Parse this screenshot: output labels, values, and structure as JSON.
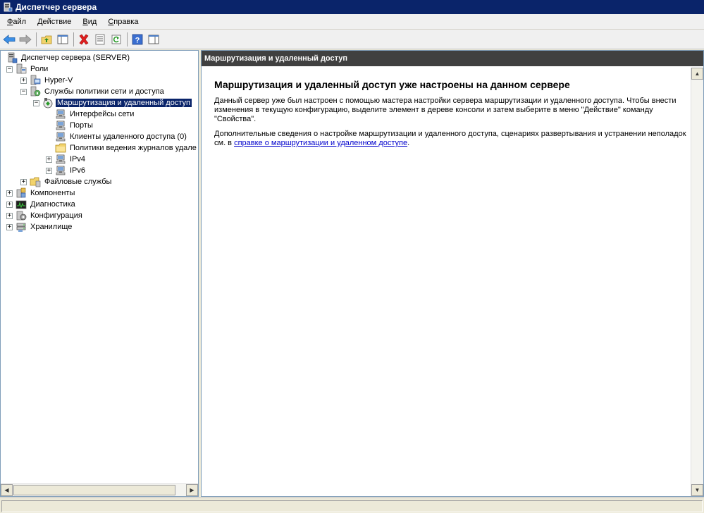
{
  "window": {
    "title": "Диспетчер сервера"
  },
  "menu": [
    {
      "label": "Файл",
      "accel": "Ф"
    },
    {
      "label": "Действие",
      "accel": "Д"
    },
    {
      "label": "Вид",
      "accel": "В"
    },
    {
      "label": "Справка",
      "accel": "С"
    }
  ],
  "toolbar": [
    {
      "name": "back-button",
      "icon": "back-arrow-icon"
    },
    {
      "name": "forward-button",
      "icon": "forward-arrow-icon"
    },
    {
      "name": "up-folder-button",
      "icon": "up-folder-icon"
    },
    {
      "name": "show-hide-tree-button",
      "icon": "console-tree-icon"
    },
    {
      "name": "delete-button",
      "icon": "delete-x-icon"
    },
    {
      "name": "properties-button",
      "icon": "properties-icon"
    },
    {
      "name": "refresh-button",
      "icon": "refresh-icon"
    },
    {
      "name": "help-button",
      "icon": "help-icon"
    },
    {
      "name": "action-pane-button",
      "icon": "action-pane-icon"
    }
  ],
  "tree": [
    {
      "label": "Диспетчер сервера (SERVER)",
      "level": 0,
      "expander": "none",
      "icon": "server-manager-icon"
    },
    {
      "label": "Роли",
      "level": 0,
      "expander": "minus",
      "icon": "roles-icon"
    },
    {
      "label": "Hyper-V",
      "level": 1,
      "expander": "plus",
      "icon": "hyperv-icon"
    },
    {
      "label": "Службы политики сети и доступа",
      "level": 1,
      "expander": "minus",
      "icon": "network-policy-icon"
    },
    {
      "label": "Маршрутизация и удаленный доступ",
      "level": 2,
      "expander": "minus",
      "icon": "routing-icon",
      "selected": true
    },
    {
      "label": "Интерфейсы сети",
      "level": 3,
      "expander": "none",
      "icon": "network-interfaces-icon"
    },
    {
      "label": "Порты",
      "level": 3,
      "expander": "none",
      "icon": "ports-icon"
    },
    {
      "label": "Клиенты удаленного доступа (0)",
      "level": 3,
      "expander": "none",
      "icon": "remote-clients-icon"
    },
    {
      "label": "Политики ведения журналов удале",
      "level": 3,
      "expander": "none",
      "icon": "folder-icon"
    },
    {
      "label": "IPv4",
      "level": 3,
      "expander": "plus",
      "icon": "ipv4-icon"
    },
    {
      "label": "IPv6",
      "level": 3,
      "expander": "plus",
      "icon": "ipv6-icon"
    },
    {
      "label": "Файловые службы",
      "level": 1,
      "expander": "plus",
      "icon": "file-services-icon"
    },
    {
      "label": "Компоненты",
      "level": 0,
      "expander": "plus",
      "icon": "features-icon"
    },
    {
      "label": "Диагностика",
      "level": 0,
      "expander": "plus",
      "icon": "diagnostics-icon"
    },
    {
      "label": "Конфигурация",
      "level": 0,
      "expander": "plus",
      "icon": "configuration-icon"
    },
    {
      "label": "Хранилище",
      "level": 0,
      "expander": "plus",
      "icon": "storage-icon"
    }
  ],
  "right_pane": {
    "header": "Маршрутизация и удаленный доступ",
    "title": "Маршрутизация и удаленный доступ уже настроены на данном сервере",
    "para1": "Данный сервер уже был настроен с помощью мастера настройки сервера маршрутизации и удаленного доступа. Чтобы внести изменения в текущую конфигурацию, выделите элемент в дереве консоли и затем выберите в меню \"Действие\" команду \"Свойства\".",
    "para2_before": "Дополнительные сведения о настройке маршрутизации и удаленного доступа, сценариях развертывания и устранении неполадок см. в ",
    "para2_link": "справке о маршрутизации и удаленном доступе",
    "para2_after": "."
  },
  "colors": {
    "titlebar": "#0a246a",
    "selection": "#0a246a",
    "pane_header": "#404040",
    "link": "#0000cc"
  }
}
